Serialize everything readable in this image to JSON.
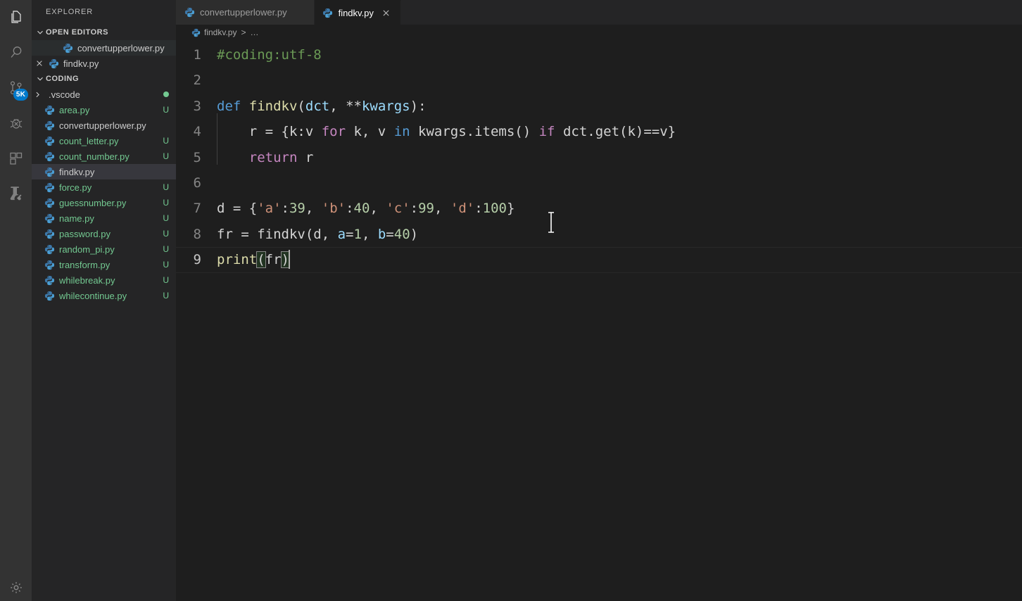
{
  "activity_bar": {
    "items": [
      {
        "name": "explorer",
        "icon": "files-icon",
        "active": true,
        "badge": ""
      },
      {
        "name": "search",
        "icon": "search-icon",
        "active": false,
        "badge": ""
      },
      {
        "name": "source-control",
        "icon": "source-control-icon",
        "active": false,
        "badge": "5K"
      },
      {
        "name": "run-and-debug",
        "icon": "debug-icon",
        "active": false,
        "badge": ""
      },
      {
        "name": "extensions",
        "icon": "extensions-icon",
        "active": false,
        "badge": ""
      },
      {
        "name": "testing",
        "icon": "testing-beaker-icon",
        "active": false,
        "badge": ""
      }
    ],
    "bottom": [
      {
        "name": "manage-settings",
        "icon": "gear-icon",
        "badge": ""
      }
    ],
    "badge_color": "#007acc"
  },
  "sidebar": {
    "title": "EXPLORER",
    "open_editors": {
      "label": "OPEN EDITORS",
      "expanded": true,
      "items": [
        {
          "label": "convertupperlower.py",
          "icon": "python-file-icon",
          "state": "hover",
          "has_close": false
        },
        {
          "label": "findkv.py",
          "icon": "python-file-icon",
          "state": "normal",
          "has_close": true
        }
      ]
    },
    "folder": {
      "label": "CODING",
      "expanded": true,
      "items": [
        {
          "label": ".vscode",
          "kind": "folder",
          "status": "",
          "status_kind": "dot",
          "selected": false,
          "color": "white"
        },
        {
          "label": "area.py",
          "kind": "file",
          "status": "U",
          "status_kind": "text",
          "selected": false,
          "color": "green"
        },
        {
          "label": "convertupperlower.py",
          "kind": "file",
          "status": "",
          "status_kind": "none",
          "selected": false,
          "color": "white"
        },
        {
          "label": "count_letter.py",
          "kind": "file",
          "status": "U",
          "status_kind": "text",
          "selected": false,
          "color": "green"
        },
        {
          "label": "count_number.py",
          "kind": "file",
          "status": "U",
          "status_kind": "text",
          "selected": false,
          "color": "green"
        },
        {
          "label": "findkv.py",
          "kind": "file",
          "status": "",
          "status_kind": "none",
          "selected": true,
          "color": "white"
        },
        {
          "label": "force.py",
          "kind": "file",
          "status": "U",
          "status_kind": "text",
          "selected": false,
          "color": "green"
        },
        {
          "label": "guessnumber.py",
          "kind": "file",
          "status": "U",
          "status_kind": "text",
          "selected": false,
          "color": "green"
        },
        {
          "label": "name.py",
          "kind": "file",
          "status": "U",
          "status_kind": "text",
          "selected": false,
          "color": "green"
        },
        {
          "label": "password.py",
          "kind": "file",
          "status": "U",
          "status_kind": "text",
          "selected": false,
          "color": "green"
        },
        {
          "label": "random_pi.py",
          "kind": "file",
          "status": "U",
          "status_kind": "text",
          "selected": false,
          "color": "green"
        },
        {
          "label": "transform.py",
          "kind": "file",
          "status": "U",
          "status_kind": "text",
          "selected": false,
          "color": "green"
        },
        {
          "label": "whilebreak.py",
          "kind": "file",
          "status": "U",
          "status_kind": "text",
          "selected": false,
          "color": "green"
        },
        {
          "label": "whilecontinue.py",
          "kind": "file",
          "status": "U",
          "status_kind": "text",
          "selected": false,
          "color": "green"
        }
      ]
    }
  },
  "tabs": [
    {
      "label": "convertupperlower.py",
      "active": false,
      "icon": "python-file-icon"
    },
    {
      "label": "findkv.py",
      "active": true,
      "icon": "python-file-icon",
      "close": "×"
    }
  ],
  "breadcrumb": {
    "file": "findkv.py",
    "separator": ">",
    "tail": "…"
  },
  "editor": {
    "language": "python",
    "cursor_line": 9,
    "line_numbers": [
      "1",
      "2",
      "3",
      "4",
      "5",
      "6",
      "7",
      "8",
      "9"
    ],
    "lines": [
      "#coding:utf-8",
      "",
      "def findkv(dct, **kwargs):",
      "    r = {k:v for k, v in kwargs.items() if dct.get(k)==v}",
      "    return r",
      "",
      "d = {'a':39, 'b':40, 'c':99, 'd':100}",
      "fr = findkv(d, a=1, b=40)",
      "print(fr)"
    ],
    "colors": {
      "background": "#1e1e1e",
      "foreground": "#d4d4d4",
      "comment": "#6a9955",
      "keyword": "#569cd6",
      "control": "#c586c0",
      "function": "#dcdcaa",
      "parameter": "#9cdcfe",
      "string": "#ce9178",
      "number": "#b5cea8",
      "line_number": "#858585",
      "active_line_number": "#c6c6c6"
    },
    "tokens": [
      [
        {
          "t": "#coding:utf-8",
          "c": "comment"
        }
      ],
      [],
      [
        {
          "t": "def",
          "c": "keyword"
        },
        {
          "t": " ",
          "c": "plain"
        },
        {
          "t": "findkv",
          "c": "function"
        },
        {
          "t": "(",
          "c": "plain"
        },
        {
          "t": "dct",
          "c": "parameter"
        },
        {
          "t": ", ",
          "c": "plain"
        },
        {
          "t": "**",
          "c": "plain"
        },
        {
          "t": "kwargs",
          "c": "parameter"
        },
        {
          "t": "):",
          "c": "plain"
        }
      ],
      [
        {
          "t": "    r = {k:v ",
          "c": "plain"
        },
        {
          "t": "for",
          "c": "control"
        },
        {
          "t": " k, v ",
          "c": "plain"
        },
        {
          "t": "in",
          "c": "keyword"
        },
        {
          "t": " kwargs.items() ",
          "c": "plain"
        },
        {
          "t": "if",
          "c": "control"
        },
        {
          "t": " dct.get(k)==v}",
          "c": "plain"
        }
      ],
      [
        {
          "t": "    ",
          "c": "plain"
        },
        {
          "t": "return",
          "c": "control"
        },
        {
          "t": " r",
          "c": "plain"
        }
      ],
      [],
      [
        {
          "t": "d = {",
          "c": "plain"
        },
        {
          "t": "'a'",
          "c": "string"
        },
        {
          "t": ":",
          "c": "plain"
        },
        {
          "t": "39",
          "c": "number"
        },
        {
          "t": ", ",
          "c": "plain"
        },
        {
          "t": "'b'",
          "c": "string"
        },
        {
          "t": ":",
          "c": "plain"
        },
        {
          "t": "40",
          "c": "number"
        },
        {
          "t": ", ",
          "c": "plain"
        },
        {
          "t": "'c'",
          "c": "string"
        },
        {
          "t": ":",
          "c": "plain"
        },
        {
          "t": "99",
          "c": "number"
        },
        {
          "t": ", ",
          "c": "plain"
        },
        {
          "t": "'d'",
          "c": "string"
        },
        {
          "t": ":",
          "c": "plain"
        },
        {
          "t": "100",
          "c": "number"
        },
        {
          "t": "}",
          "c": "plain"
        }
      ],
      [
        {
          "t": "fr = findkv(d, ",
          "c": "plain"
        },
        {
          "t": "a",
          "c": "parameter"
        },
        {
          "t": "=",
          "c": "plain"
        },
        {
          "t": "1",
          "c": "number"
        },
        {
          "t": ", ",
          "c": "plain"
        },
        {
          "t": "b",
          "c": "parameter"
        },
        {
          "t": "=",
          "c": "plain"
        },
        {
          "t": "40",
          "c": "number"
        },
        {
          "t": ")",
          "c": "plain"
        }
      ],
      [
        {
          "t": "print",
          "c": "function"
        },
        {
          "t": "(",
          "c": "plain",
          "bracket": true
        },
        {
          "t": "fr",
          "c": "plain"
        },
        {
          "t": ")",
          "c": "plain",
          "bracket": true
        }
      ]
    ]
  }
}
